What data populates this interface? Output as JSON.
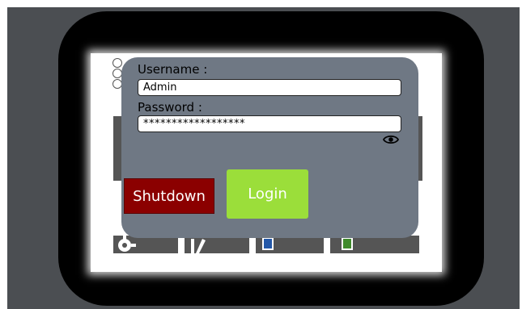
{
  "login_dialog": {
    "username_label": "Username :",
    "username_value": "Admin",
    "password_label": "Password :",
    "password_value": "******************",
    "show_password_icon": "eye-icon",
    "shutdown_label": "Shutdown",
    "login_label": "Login"
  },
  "colors": {
    "dialog_bg": "#6f7884",
    "shutdown_bg": "#8b0000",
    "login_bg": "#9bde3a",
    "bezel": "#000000",
    "backdrop": "#4b4e52"
  },
  "background_icons": [
    "gear-icon",
    "pencil-icon",
    "blue-square-icon",
    "green-square-icon"
  ]
}
